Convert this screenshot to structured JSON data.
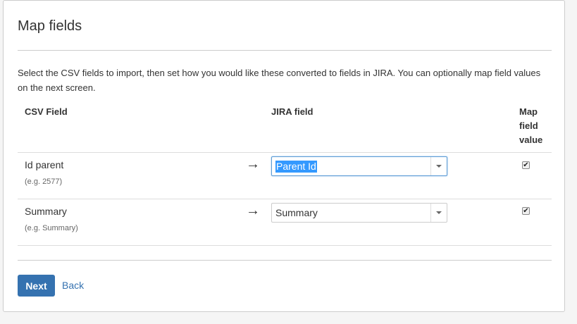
{
  "title": "Map fields",
  "description": "Select the CSV fields to import, then set how you would like these converted to fields in JIRA. You can optionally map field values on the next screen.",
  "columns": {
    "csv_field": "CSV Field",
    "jira_field": "JIRA field",
    "map_value": [
      "Map",
      "field",
      "value"
    ]
  },
  "rows": [
    {
      "csv_name": "Id parent",
      "example": "(e.g. 2577)",
      "arrow": "→",
      "jira_value": "Parent Id",
      "map_checked": true
    },
    {
      "csv_name": "Summary",
      "example": "(e.g. Summary)",
      "arrow": "→",
      "jira_value": "Summary",
      "map_checked": true
    }
  ],
  "actions": {
    "next_label": "Next",
    "back_label": "Back"
  },
  "colors": {
    "primary": "#3572b0",
    "selection": "#3399ff"
  },
  "icons": {
    "checkbox_checked": "✔",
    "select_caret": "chevron-down-icon"
  }
}
